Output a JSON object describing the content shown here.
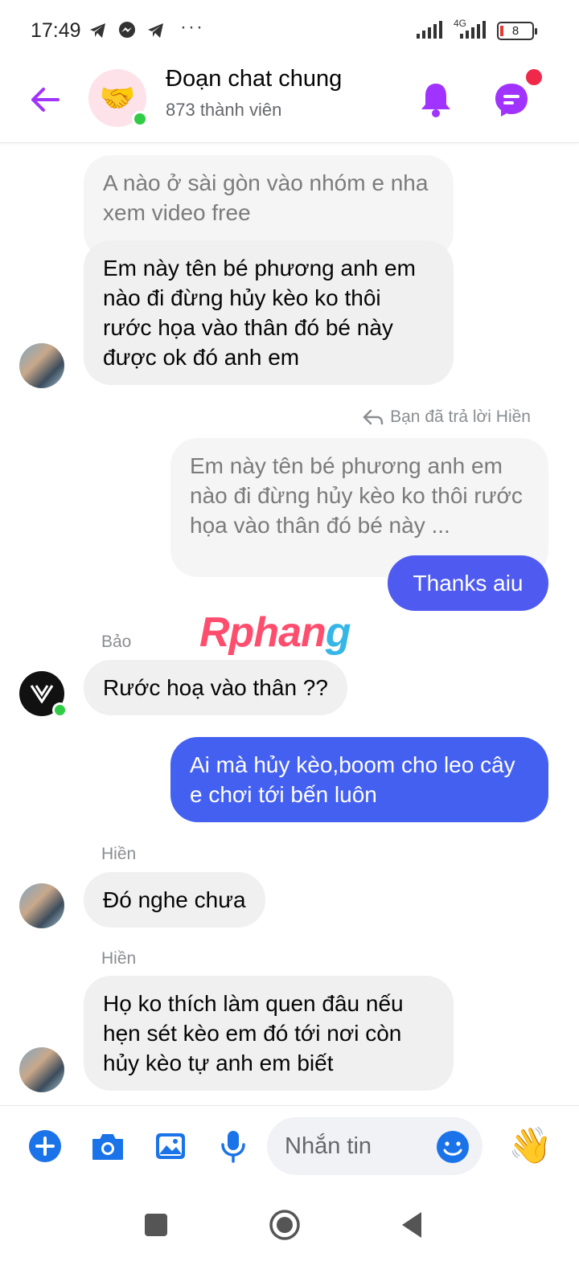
{
  "status_bar": {
    "time": "17:49",
    "dots": "···",
    "network": "4G",
    "battery": "8"
  },
  "header": {
    "title": "Đoạn chat chung",
    "subtitle": "873 thành viên",
    "avatar_emoji": "🤝",
    "icons": [
      "back-arrow-icon",
      "bell-icon",
      "messenger-chat-icon"
    ],
    "accent_color": "#a033ff"
  },
  "messages": [
    {
      "type": "incoming",
      "text": "A nào ở sài gòn vào nhóm e nha xem video free",
      "style": "quoted"
    },
    {
      "type": "incoming",
      "text": "Em này tên bé phương anh em nào đi đừng hủy kèo ko thôi rước họa vào thân đó bé này được ok đó anh em"
    },
    {
      "type": "reply_meta",
      "text": "Bạn đã trả lời Hiền"
    },
    {
      "type": "outgoing_quote",
      "text": "Em này tên bé phương anh em nào đi đừng hủy kèo ko thôi rước họa vào thân đó bé này ..."
    },
    {
      "type": "outgoing",
      "text": "Thanks aiu"
    },
    {
      "type": "incoming",
      "sender": "Bảo",
      "text": "Rước hoạ vào thân ??"
    },
    {
      "type": "outgoing",
      "text": "Ai mà hủy kèo,boom cho leo cây e chơi tới bến luôn"
    },
    {
      "type": "incoming",
      "sender": "Hiền",
      "text": "Đó nghe chưa"
    },
    {
      "type": "incoming",
      "sender": "Hiền",
      "text": "Họ ko thích làm quen đâu nếu hẹn sét kèo em đó tới nơi còn hủy kèo tự anh em biết"
    }
  ],
  "watermark": {
    "part1": "Rphan",
    "part2": "g"
  },
  "composer": {
    "placeholder": "Nhắn tin",
    "wave_emoji": "👋",
    "icons": [
      "plus-icon",
      "camera-icon",
      "image-icon",
      "microphone-icon",
      "emoji-icon"
    ]
  },
  "colors": {
    "outgoing_bubble": "#4f5bf0",
    "incoming_bubble": "#f0f0f0",
    "icon_blue": "#1a73e8",
    "online": "#31cc46"
  }
}
